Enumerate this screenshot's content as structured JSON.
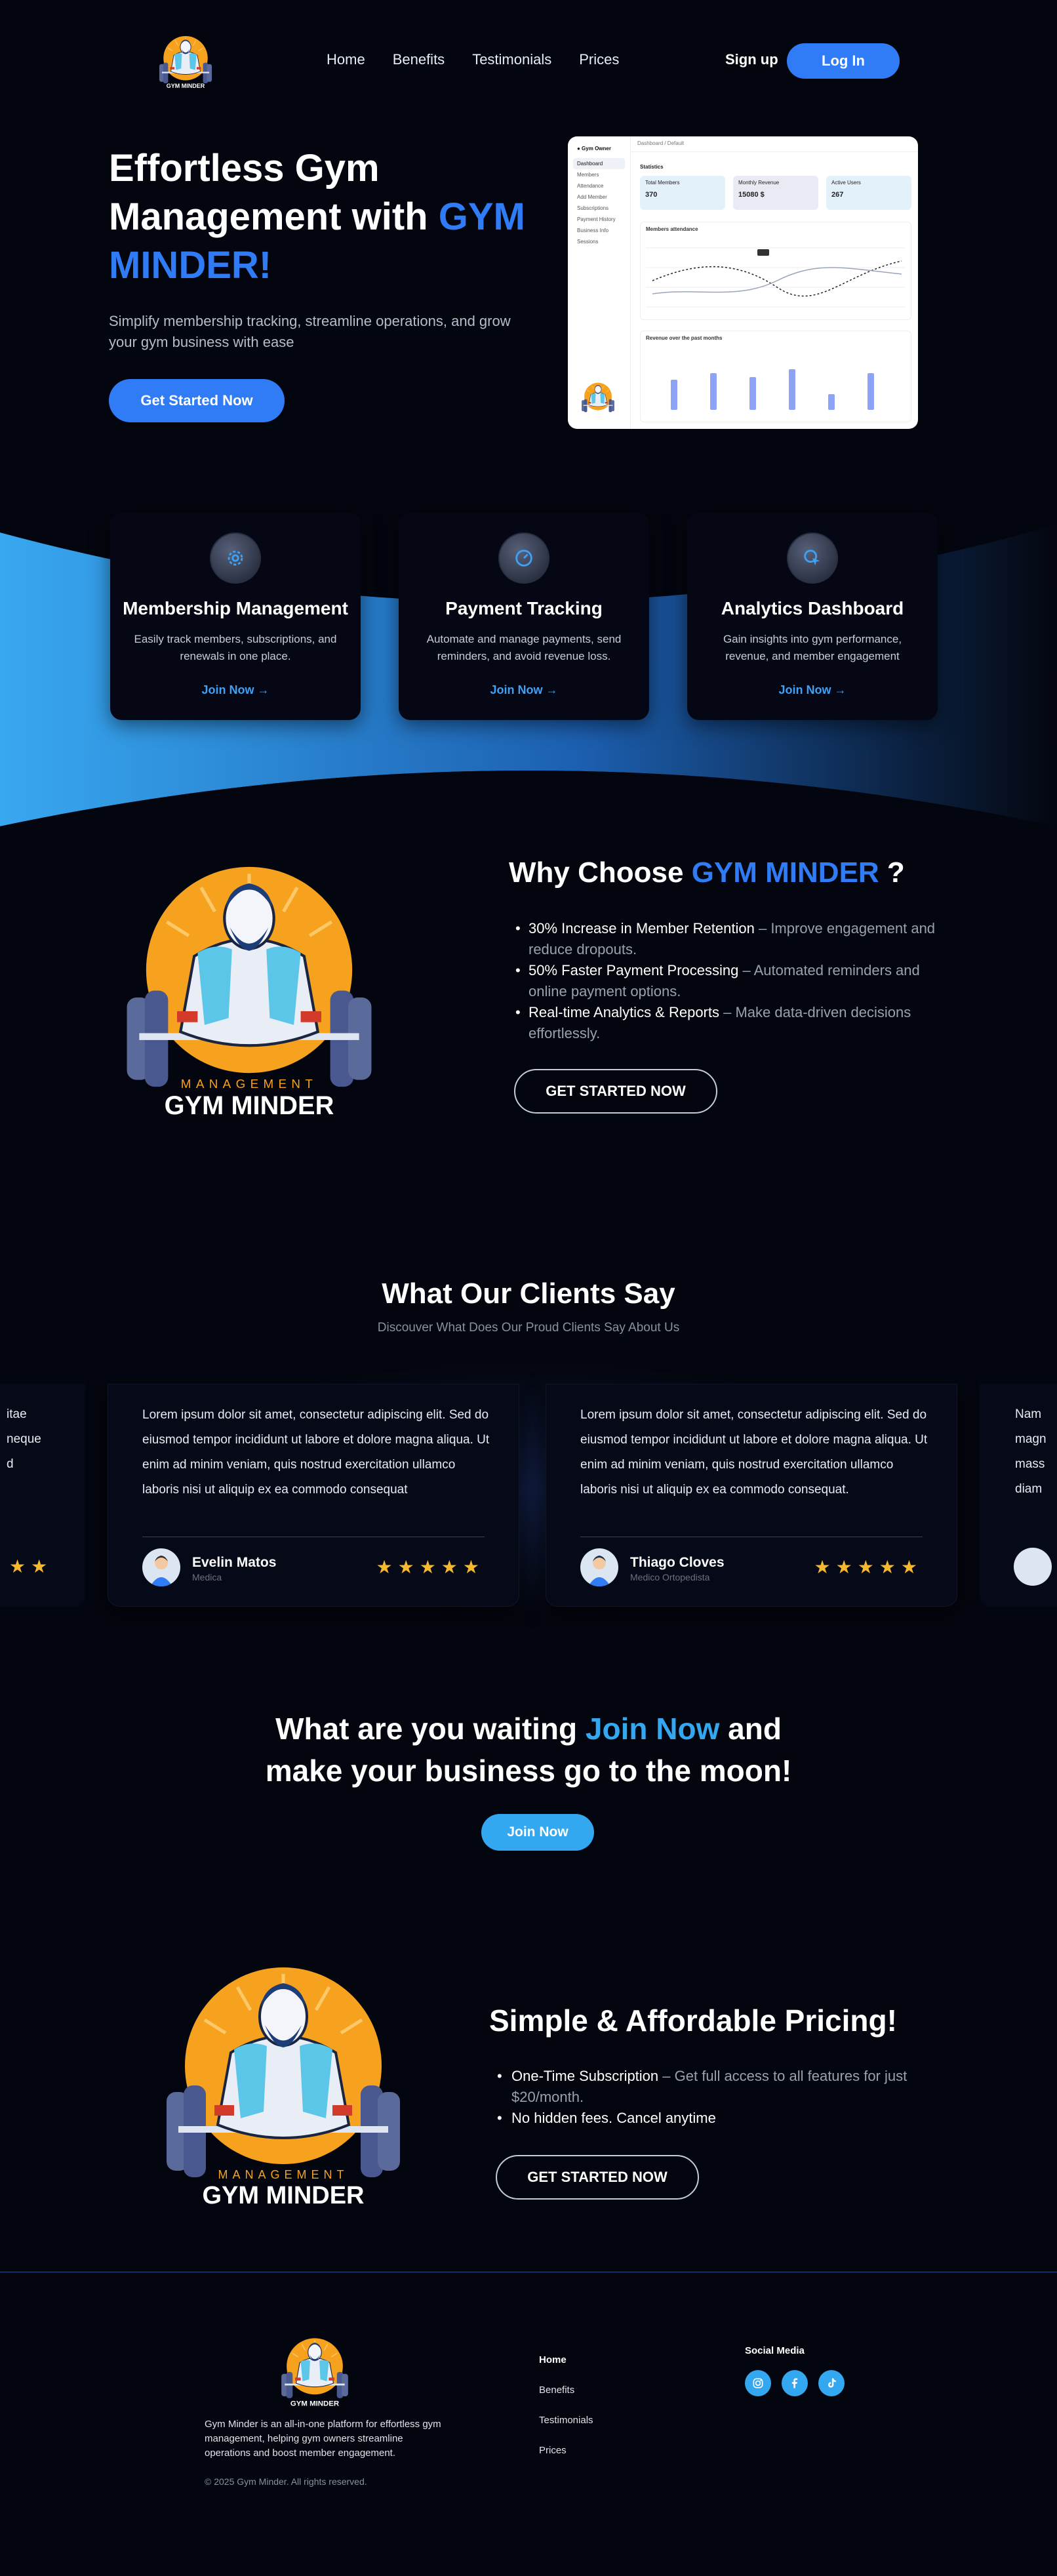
{
  "brand": {
    "name": "GYM MINDER",
    "logo_top": "MANAGEMENT",
    "logo_bottom": "GYM MINDER"
  },
  "nav": {
    "links": [
      "Home",
      "Benefits",
      "Testimonials",
      "Prices"
    ],
    "signup": "Sign up",
    "login": "Log In"
  },
  "hero": {
    "title_a": "Effortless Gym Management with ",
    "title_b": "GYM MINDER!",
    "subtitle": "Simplify membership tracking, streamline operations, and grow your gym business with ease",
    "cta": "Get Started Now"
  },
  "dashboard": {
    "side": [
      "Dashboard",
      "Members",
      "Attendance",
      "Add Member",
      "Subscriptions",
      "Payment History",
      "Business Info",
      "Sessions"
    ],
    "topbar": "Dashboard  /  Default",
    "stats_title": "Statistics",
    "stats": [
      {
        "label": "Total Members",
        "value": "370"
      },
      {
        "label": "Monthly Revenue",
        "value": "15080 $"
      },
      {
        "label": "Active Users",
        "value": "267"
      }
    ],
    "panel1": "Members attendance",
    "panel2": "Revenue over the past months"
  },
  "features": [
    {
      "title": "Membership Management",
      "desc": "Easily track members, subscriptions, and renewals in one place.",
      "link": "Join Now",
      "icon": "gear-icon"
    },
    {
      "title": "Payment Tracking",
      "desc": "Automate and manage payments, send reminders, and avoid revenue loss.",
      "link": "Join Now",
      "icon": "gauge-icon"
    },
    {
      "title": "Analytics Dashboard",
      "desc": "Gain insights into gym performance, revenue, and member engagement",
      "link": "Join Now",
      "icon": "cursor-click-icon"
    }
  ],
  "why": {
    "title_a": "Why Choose ",
    "title_b": "GYM MINDER",
    "title_c": " ?",
    "items": [
      {
        "k": "30% Increase in Member Retention",
        "v": " – Improve engagement and reduce dropouts."
      },
      {
        "k": "50% Faster Payment Processing",
        "v": " –  Automated reminders and online payment options."
      },
      {
        "k": "Real-time Analytics & Reports",
        "v": " –  Make data-driven decisions effortlessly."
      }
    ],
    "cta": "GET STARTED NOW"
  },
  "testimonials": {
    "title": "What Our Clients Say",
    "subtitle": "Discouver What Does Our Proud Clients Say About Us",
    "left_peek": "itae\nneque\nd",
    "right_peek": "Nam\nmagn\nmass\ndiam",
    "stars": "★★★★★",
    "edge_stars": "★★",
    "cards": [
      {
        "quote": "Lorem ipsum dolor sit amet, consectetur adipiscing elit. Sed do eiusmod tempor incididunt ut labore et dolore magna aliqua. Ut enim ad minim veniam, quis nostrud exercitation ullamco laboris nisi ut aliquip ex ea commodo consequat",
        "name": "Evelin Matos",
        "role": "Medica"
      },
      {
        "quote": "Lorem ipsum dolor sit amet, consectetur adipiscing elit. Sed do eiusmod tempor incididunt ut labore et dolore magna aliqua. Ut enim ad minim veniam, quis nostrud exercitation ullamco laboris nisi ut aliquip ex ea commodo consequat.",
        "name": "Thiago Cloves",
        "role": "Medico Ortopedista"
      }
    ]
  },
  "cta": {
    "line1_a": "What are you waiting ",
    "line1_b": "Join Now",
    "line1_c": " and",
    "line2": "make your business go to the moon!",
    "button": "Join Now"
  },
  "pricing": {
    "title": "Simple & Affordable Pricing!",
    "items": [
      {
        "k": "One-Time Subscription",
        "v": " – Get full access to all features for just $20/month."
      },
      {
        "k": "No hidden fees. Cancel anytime",
        "v": ""
      }
    ],
    "cta": "GET STARTED NOW"
  },
  "footer": {
    "desc": "Gym Minder is an all-in-one platform for effortless gym management, helping gym owners streamline operations and boost member engagement.",
    "copyright": "© 2025 Gym Minder. All rights reserved.",
    "links": [
      "Home",
      "Benefits",
      "Testimonials",
      "Prices"
    ],
    "social_title": "Social Media",
    "social_icons": [
      "instagram-icon",
      "facebook-icon",
      "tiktok-icon"
    ]
  },
  "colors": {
    "accent": "#2f7cf6",
    "sky": "#33a7f0",
    "bg": "#04060f",
    "gold": "#f5b82e"
  }
}
